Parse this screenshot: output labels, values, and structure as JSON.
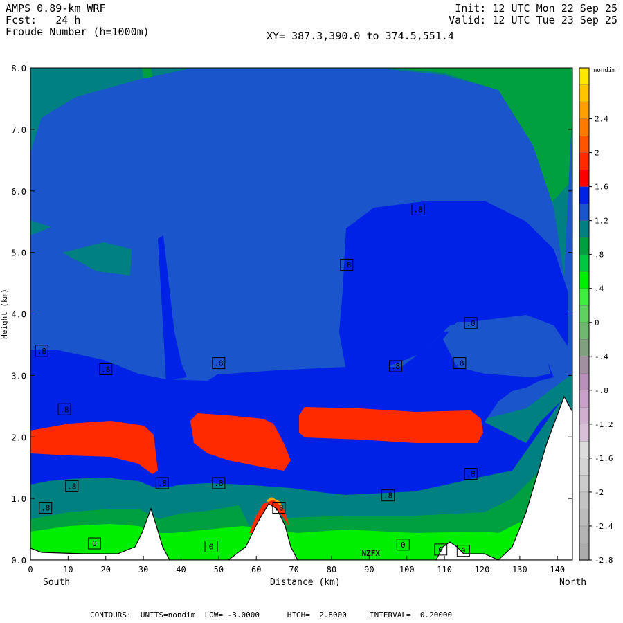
{
  "header": {
    "model": "AMPS 0.89-km WRF",
    "fcst": "Fcst:   24 h",
    "field": "Froude Number (h=1000m)",
    "init": "Init: 12 UTC Mon 22 Sep 25",
    "valid": "Valid: 12 UTC Tue 23 Sep 25",
    "xy": "XY= 387.3,390.0 to 374.5,551.4"
  },
  "labels": {
    "south": "South",
    "north": "North",
    "xlabel": "Distance (km)",
    "ylabel": "Height (km)",
    "unit": "nondim",
    "mark": "NZFX"
  },
  "footer": "CONTOURS:  UNITS=nondim  LOW= -3.0000      HIGH=  2.8000     INTERVAL=  0.20000",
  "chart_data": {
    "type": "heatmap",
    "xlim": [
      0,
      144
    ],
    "ylim": [
      0,
      8
    ],
    "x_ticks": [
      0,
      10,
      20,
      30,
      40,
      50,
      60,
      70,
      80,
      90,
      100,
      110,
      120,
      130,
      140
    ],
    "y_ticks": [
      "0.0",
      "1.0",
      "2.0",
      "3.0",
      "4.0",
      "5.0",
      "6.0",
      "7.0",
      "8.0"
    ],
    "colorbar": {
      "label": "nondim",
      "tick_labels": [
        "2.4",
        "2",
        "1.6",
        "1.2",
        ".8",
        ".4",
        "0",
        "-.4",
        "-.8",
        "-1.2",
        "-1.6",
        "-2",
        "-2.4",
        "-2.8"
      ],
      "colors": [
        "#ffe800",
        "#ffc400",
        "#ffa000",
        "#ff7c00",
        "#ff5500",
        "#ff2a00",
        "#ff0000",
        "#0022e6",
        "#1a55cc",
        "#008080",
        "#00a040",
        "#00c840",
        "#00ee00",
        "#40ee40",
        "#60d060",
        "#70b870",
        "#80a080",
        "#a090a0",
        "#b890b8",
        "#c8a0c8",
        "#d0b0d0",
        "#d8c0d8",
        "#dcdcdc",
        "#d4d4d4",
        "#cccccc",
        "#c4c4c4",
        "#bcbcbc",
        "#b4b4b4",
        "#acacac"
      ]
    },
    "contour_labels": [
      {
        "text": ".8",
        "x": 3,
        "y": 3.4
      },
      {
        "text": ".8",
        "x": 20,
        "y": 3.1
      },
      {
        "text": ".8",
        "x": 50,
        "y": 3.2
      },
      {
        "text": ".8",
        "x": 84,
        "y": 4.8
      },
      {
        "text": ".8",
        "x": 103,
        "y": 5.7
      },
      {
        "text": ".8",
        "x": 117,
        "y": 3.85
      },
      {
        "text": ".8",
        "x": 97,
        "y": 3.15
      },
      {
        "text": ".8",
        "x": 114,
        "y": 3.2
      },
      {
        "text": ".8",
        "x": 9,
        "y": 2.45
      },
      {
        "text": ".8",
        "x": 35,
        "y": 1.25
      },
      {
        "text": ".8",
        "x": 50,
        "y": 1.25
      },
      {
        "text": ".8",
        "x": 95,
        "y": 1.05
      },
      {
        "text": ".8",
        "x": 117,
        "y": 1.4
      },
      {
        "text": ".8",
        "x": 11,
        "y": 1.2
      },
      {
        "text": ".8",
        "x": 4,
        "y": 0.85
      },
      {
        "text": ".8",
        "x": 66,
        "y": 0.85
      },
      {
        "text": "0",
        "x": 17,
        "y": 0.27
      },
      {
        "text": "0",
        "x": 48,
        "y": 0.22
      },
      {
        "text": "0",
        "x": 99,
        "y": 0.25
      },
      {
        "text": "0",
        "x": 109,
        "y": 0.17
      },
      {
        "text": "0",
        "x": 115,
        "y": 0.15
      }
    ]
  }
}
